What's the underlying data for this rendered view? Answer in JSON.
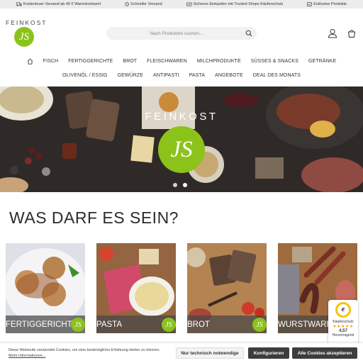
{
  "topbar": {
    "items": [
      {
        "icon": "truck-icon",
        "label": "Kostenloser Versand ab 40 € Warenkorbwert"
      },
      {
        "icon": "clock-icon",
        "label": "Schneller Versand"
      },
      {
        "icon": "shield-icon",
        "label": "Sicheres Einkaufen mit Trusted Shops Käuferschutz"
      },
      {
        "icon": "star-icon",
        "label": "Exklusive Produkte"
      }
    ]
  },
  "logo": {
    "word": "FEINKOST",
    "mark": "JS"
  },
  "search": {
    "placeholder": "Nach Produkten suchen..."
  },
  "nav": {
    "row1": [
      "FISCH",
      "FERTIGGERICHTE",
      "BROT",
      "FLEISCHWAREN",
      "MILCHPRODUKTE",
      "SÜSSES & SNACKS",
      "GETRÄNKE"
    ],
    "row2": [
      "OLIVENÖL / ESSIG",
      "GEWÜRZE",
      "ANTIPASTI",
      "PASTA",
      "ANGEBOTE",
      "DEAL DES MONATS"
    ]
  },
  "hero": {
    "brand": "FEINKOST",
    "mark": "JS"
  },
  "headline": "WAS DARF ES SEIN?",
  "categories": [
    {
      "label": "FERTIGGERICHTE",
      "badge": "JS"
    },
    {
      "label": "PASTA",
      "badge": "JS"
    },
    {
      "label": "BROT",
      "badge": "JS"
    },
    {
      "label": "WURSTWAREN",
      "badge": "JS"
    }
  ],
  "trusted": {
    "title": "Käuferschutz",
    "stars": "★★★★★",
    "rating": "4,57",
    "verdict": "Hervorragend"
  },
  "cookie": {
    "text": "Diese Webseite verwendet Cookies, um eine bestmögliche Erfahrung bieten zu können.",
    "link": "Mehr Informationen...",
    "btn_necessary": "Nur technisch notwendige",
    "btn_configure": "Konfigurieren",
    "btn_accept_all": "Alle Cookies akzeptieren"
  },
  "colors": {
    "accent": "#8bc31b",
    "dark_button": "#3d3d3d",
    "topbar_bg": "#ececec"
  }
}
